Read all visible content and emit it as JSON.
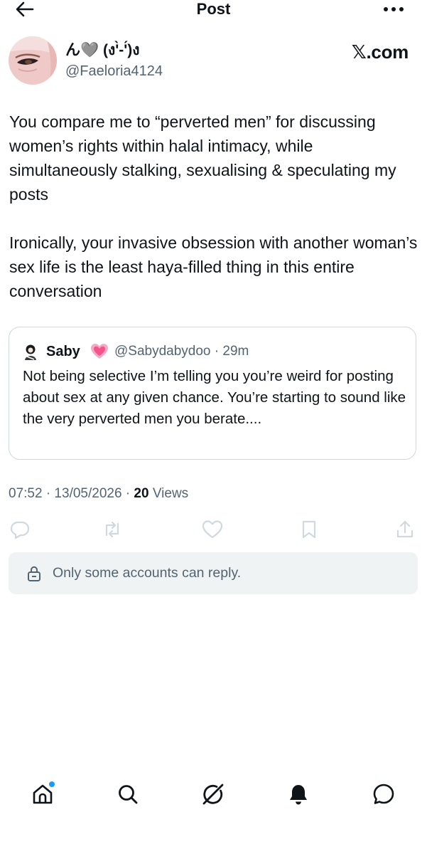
{
  "header": {
    "title": "Post",
    "back_icon": "arrow-left-icon",
    "more_icon": "more-horizontal-icon"
  },
  "post": {
    "author": {
      "display_name": "ん🩶 (ง'̀-'́)ง",
      "handle": "@Faeloria4124",
      "avatar_icon": "avatar-image"
    },
    "source_badge": "𝕏.com",
    "paragraphs": [
      "You compare me to “perverted men” for discussing women’s rights within halal intimacy, while simultaneously stalking, sexualising & speculating my posts",
      "Ironically, your invasive obsession with another woman’s sex life is the least haya-filled thing in this entire conversation"
    ],
    "quote": {
      "name": "Saby",
      "emoji": "💗",
      "handle_time": "@Sabydabydoo · 29m",
      "text": "Not being selective I’m telling you you’re weird for posting about sex at any given chance. You’re starting to sound like the very perverted men you berate...."
    },
    "meta": {
      "time_date": "07:52 · 13/05/2026 · ",
      "views_count": "20",
      "views_label": " Views"
    },
    "actions": [
      "reply-icon",
      "repost-icon",
      "like-icon",
      "bookmark-icon",
      "share-icon"
    ]
  },
  "reply_restriction": {
    "text": "Only some accounts can reply.",
    "icon": "lock-icon"
  },
  "bottom_nav": [
    "home-icon",
    "search-icon",
    "grok-icon",
    "notifications-icon",
    "messages-icon"
  ],
  "colors": {
    "text": "#0f1419",
    "secondary": "#536471",
    "accent": "#1d9bf0",
    "pink": "#f4548a",
    "border": "#cfd9de"
  }
}
